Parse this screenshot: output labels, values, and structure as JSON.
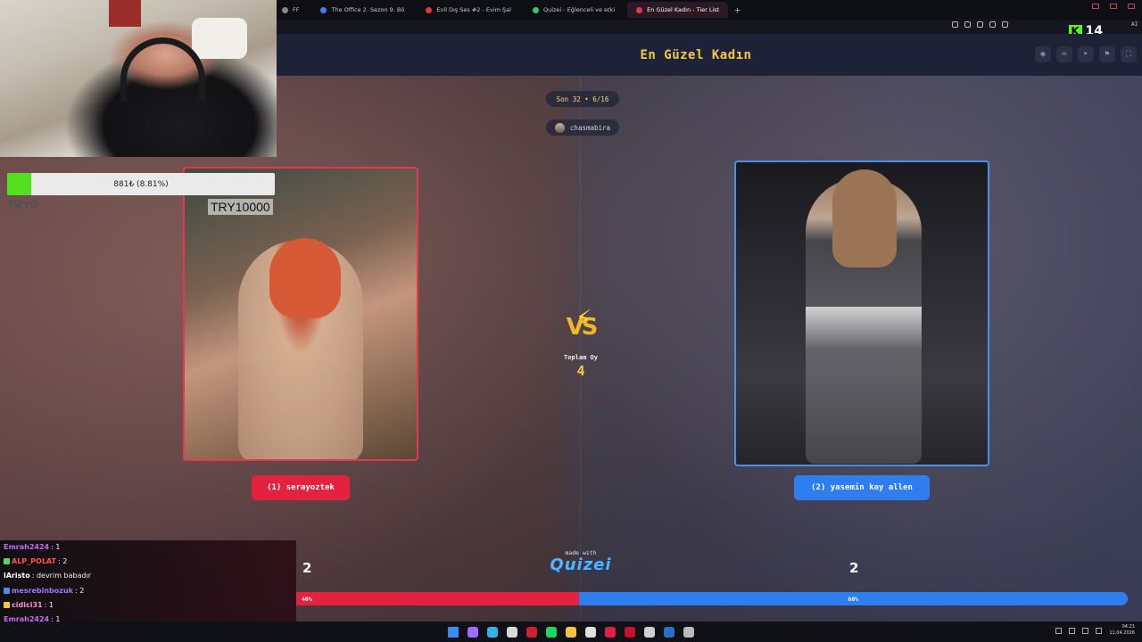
{
  "browser": {
    "tabs": [
      {
        "label": "FF",
        "color": "#888888",
        "active": false
      },
      {
        "label": "The Office 2. Sezon 9. Bö",
        "color": "#4a7cf0",
        "active": false
      },
      {
        "label": "Evil Dış Ses #2 - Evim Şal",
        "color": "#e23a3a",
        "active": false
      },
      {
        "label": "Quizei - Eğlenceli ve etki",
        "color": "#3ac46a",
        "active": false
      },
      {
        "label": "En Güzel Kadın - Tier List",
        "color": "#e8364f",
        "active": true
      }
    ],
    "new_tab": "+",
    "kick_count": "14",
    "kick_logo": "K",
    "ai_label": "AI"
  },
  "header": {
    "title": "En Güzel Kadın",
    "actions": [
      {
        "icon": "eye-icon",
        "glyph": "◉"
      },
      {
        "icon": "link-icon",
        "glyph": "∞"
      },
      {
        "icon": "send-icon",
        "glyph": "➤"
      },
      {
        "icon": "flag-icon",
        "glyph": "⚑"
      },
      {
        "icon": "fullscreen-icon",
        "glyph": "⛶"
      }
    ]
  },
  "match": {
    "round": "Son 32 • 6/16",
    "creator": "chasmabira",
    "total_label": "Toplam Oy",
    "total_votes": "4",
    "vs": "VS",
    "bolt": "⚡",
    "made_with": "made with",
    "brand": "Quizei"
  },
  "left": {
    "caption": "TRY10000",
    "button": "(1) serayoztek",
    "votes": "2",
    "percent_label": "40%",
    "share": 0.3397,
    "color": "#e3223f"
  },
  "right": {
    "button": "(2) yasemin kay allen",
    "votes": "2",
    "percent_label": "60%",
    "color": "#2f7ef0"
  },
  "goal": {
    "text": "881₺ (8.81%)",
    "progress": 0.0881,
    "currency_line": "TRY0"
  },
  "chat": [
    {
      "user": "Emrah2424",
      "message": ": 1",
      "color": "#c56cf0",
      "badge": ""
    },
    {
      "user": "ALP_POLAT",
      "message": ": 2",
      "color": "#ff5252",
      "badge": "#5cd65c"
    },
    {
      "user": "lAristo",
      "message": ": devrim babadır",
      "color": "#ffffff",
      "badge": ""
    },
    {
      "user": "mesrebinbozuk",
      "message": ": 2",
      "color": "#9b7bff",
      "badge": "#4a90e2"
    },
    {
      "user": "cidici31",
      "message": ": 1",
      "color": "#ff8fd0",
      "badge": "#f5c542"
    },
    {
      "user": "Emrah2424",
      "message": ": 1",
      "color": "#c56cf0",
      "badge": ""
    }
  ],
  "taskbar": {
    "icons": [
      "windows-start-icon",
      "copilot-icon",
      "edge-icon",
      "files-icon",
      "opera-icon",
      "spotify-icon",
      "folder-icon",
      "chrome-icon",
      "opera-gx-icon",
      "streamer-app-icon",
      "obs-icon",
      "steam-icon",
      "settings-icon"
    ],
    "icon_colors": [
      "#3c8cf5",
      "#9f6cff",
      "#2fb3e8",
      "#d9d9d9",
      "#d1202f",
      "#1ed760",
      "#f5c542",
      "#e0e0e0",
      "#e01e4a",
      "#c8102e",
      "#cfcfcf",
      "#2a6fc9",
      "#bbbbbb"
    ],
    "clock_time": "04:21",
    "clock_date": "11.04.2026"
  }
}
